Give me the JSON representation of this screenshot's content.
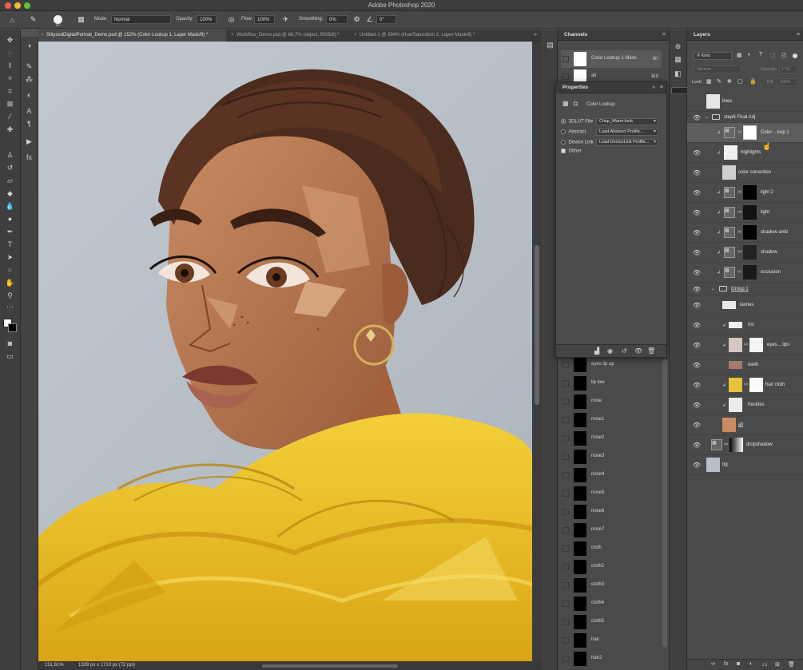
{
  "app": {
    "title": "Adobe Photoshop 2020"
  },
  "options_bar": {
    "brush_size": "47",
    "mode_label": "Mode:",
    "mode_value": "Normal",
    "opacity_label": "Opacity:",
    "opacity_value": "100%",
    "flow_label": "Flow:",
    "flow_value": "100%",
    "smoothing_label": "Smoothing:",
    "smoothing_value": "0%",
    "angle_value": "0°"
  },
  "tabs": [
    {
      "label": "StilyzedDigitalPortrait_Demo.psd @ 152% (Color Lookup 1, Layer Mask/8) *"
    },
    {
      "label": "Workflow_Demo.psd @ 66,7% (object, RGB/8) *"
    },
    {
      "label": "Untitled-1 @ 264% (Hue/Saturation 2, Layer Mask/8) *"
    }
  ],
  "status": {
    "zoom": "151,61%",
    "doc_info": "1339 px x 1710 px (72 ppi)"
  },
  "channels": {
    "title": "Channels",
    "rows_top": [
      {
        "name": "Color Lookup 1 Mask",
        "key": "⌘\\"
      },
      {
        "name": "all",
        "key": "⌘8"
      }
    ],
    "rows": [
      {
        "name": "eyes lip up"
      },
      {
        "name": "lip low"
      },
      {
        "name": "nose"
      },
      {
        "name": "nose1"
      },
      {
        "name": "nose2"
      },
      {
        "name": "nose3"
      },
      {
        "name": "nose4"
      },
      {
        "name": "nose5"
      },
      {
        "name": "nose6"
      },
      {
        "name": "nose7"
      },
      {
        "name": "cloth"
      },
      {
        "name": "cloth2"
      },
      {
        "name": "cloth3"
      },
      {
        "name": "cloth4"
      },
      {
        "name": "cloth5"
      },
      {
        "name": "hair"
      },
      {
        "name": "hair2"
      }
    ]
  },
  "properties": {
    "title": "Properties",
    "subtitle": "Color Lookup",
    "lut_label": "3DLUT File",
    "lut_value": "Crisp_Warm.look",
    "abstract_label": "Abstract",
    "abstract_value": "Load Abstract Profile...",
    "device_label": "Device Link",
    "device_value": "Load DeviceLink Profile...",
    "dither_label": "Dither"
  },
  "layers": {
    "title": "Layers",
    "kind_value": "Kind",
    "blend_value": "Normal",
    "opacity_label": "Opacity:",
    "opacity_value": "17%",
    "lock_label": "Lock:",
    "fill_label": "Fill:",
    "fill_value": "100%",
    "items": [
      {
        "name": "lines"
      },
      {
        "name": "step6 Final Adj"
      },
      {
        "name": "Color ...kup 1"
      },
      {
        "name": "highlights"
      },
      {
        "name": "color correction"
      },
      {
        "name": "light 2"
      },
      {
        "name": "light"
      },
      {
        "name": "shadow amb"
      },
      {
        "name": "shadow"
      },
      {
        "name": "occlusion"
      },
      {
        "name": "Group 1"
      },
      {
        "name": "lashes"
      },
      {
        "name": "iris"
      },
      {
        "name": "eyes....lips"
      },
      {
        "name": "teeth"
      },
      {
        "name": "hair cloth"
      },
      {
        "name": "freckles"
      },
      {
        "name": "all"
      },
      {
        "name": "dropshadow"
      },
      {
        "name": "bg"
      }
    ]
  },
  "colors": {
    "skin": "#b0714a",
    "hair": "#4a2a1c",
    "cloth": "#e7b91d",
    "canvas_bg": "#bcc3cb"
  }
}
